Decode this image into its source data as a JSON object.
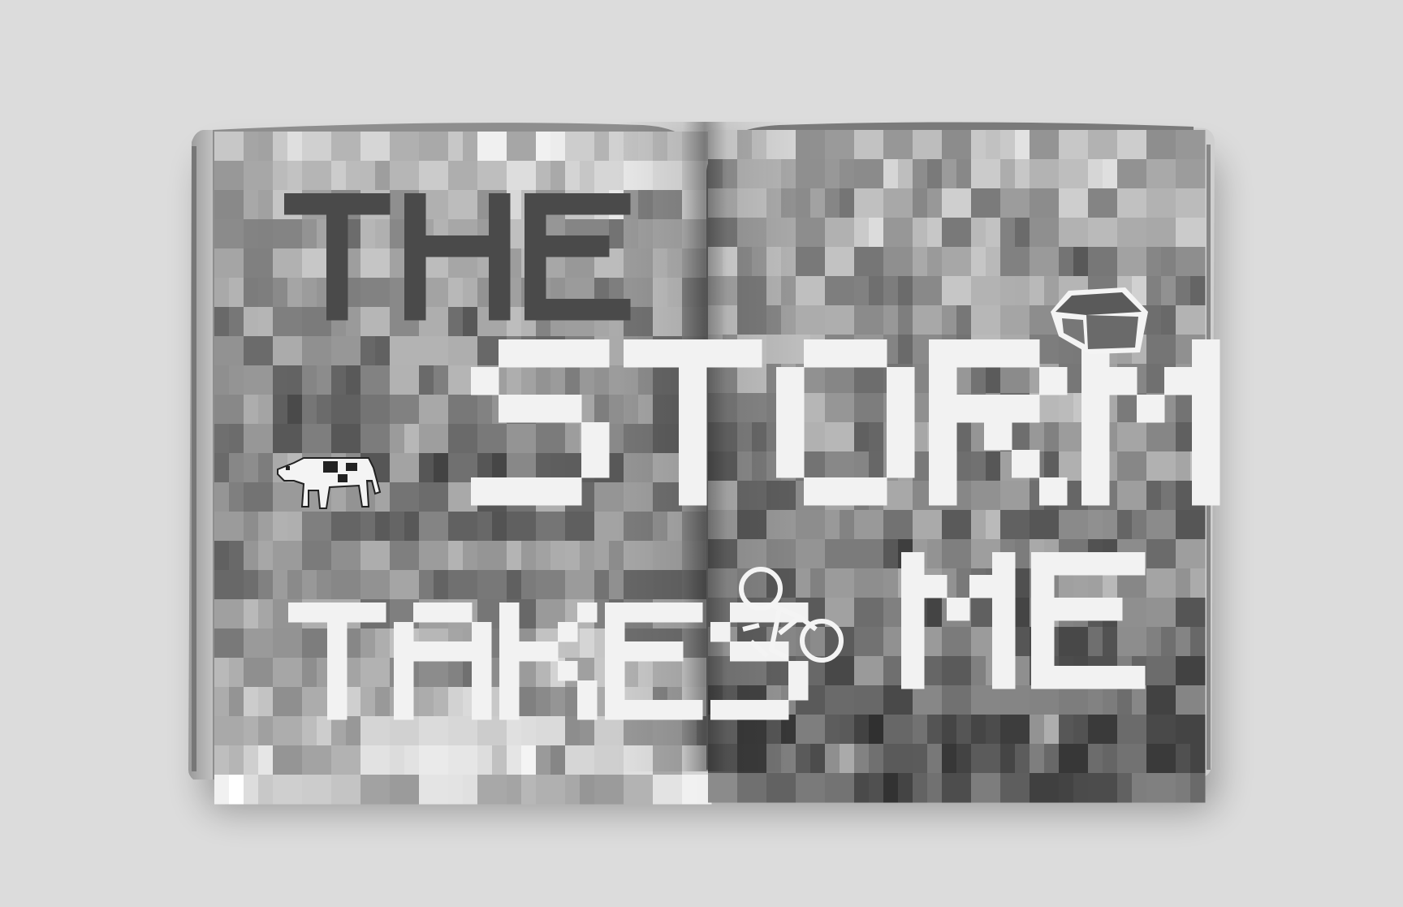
{
  "spread": {
    "line1": [
      "T",
      "H",
      "E"
    ],
    "line2": [
      "S",
      "T",
      "O",
      "R",
      "M"
    ],
    "line3": [
      "T",
      "A",
      "K",
      "E",
      "S"
    ],
    "line4": [
      "M",
      "E"
    ]
  },
  "illustrations": [
    "cow-icon",
    "house-icon",
    "bicycle-icon"
  ],
  "colors": {
    "backdrop": "#dcdcdc",
    "letters": "#f2f2f2",
    "the_letters": "#4a4a4a",
    "page_dark": "#5a5a5a",
    "page_light": "#e4e4e4"
  }
}
